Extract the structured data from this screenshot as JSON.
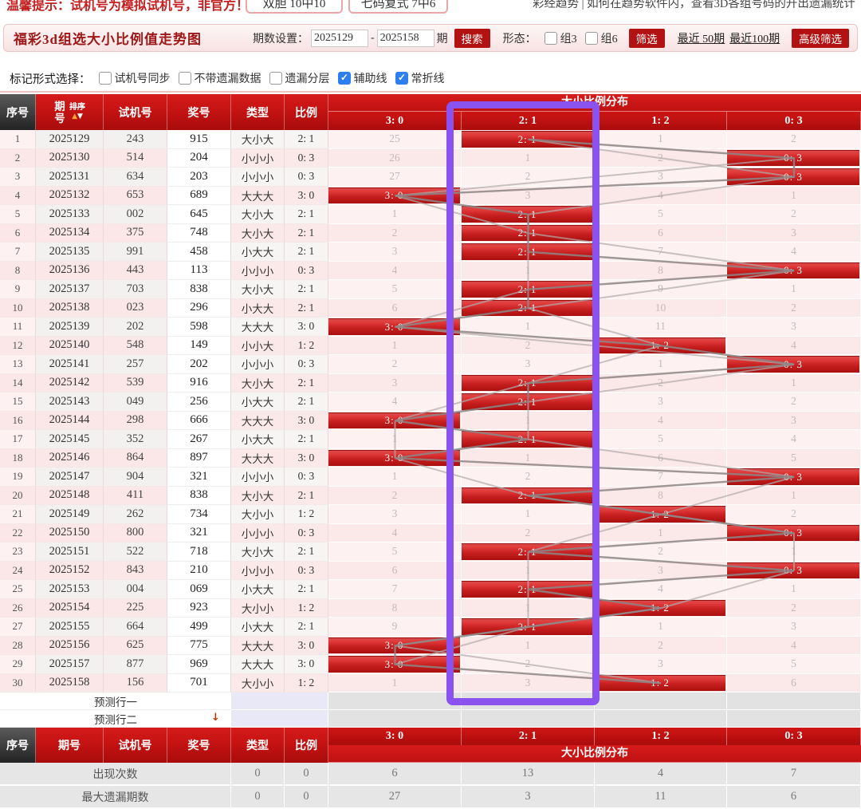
{
  "top_strip": {
    "notice": "温馨提示：试机号为模拟试机号，非官方！",
    "promo_buttons": [
      "双胆 10中10",
      "七码复式 7中6"
    ],
    "right_link": "彩经趋势 | 如何在趋势软件内，查看3D各组号码的开出遗漏统计"
  },
  "toolbar": {
    "title": "福彩3d组选大小比例值走势图",
    "period_label": "期数设置：",
    "period_from": "2025129",
    "dash": "-",
    "period_to": "2025158",
    "period_unit": "期",
    "search_button": "搜索",
    "shape_label": "形态：",
    "shape_options": [
      {
        "label": "组3",
        "checked": false
      },
      {
        "label": "组6",
        "checked": false
      }
    ],
    "filter_button": "筛选",
    "recent_50": "最近 50期",
    "recent_100": "最近100期",
    "advanced_button": "高级筛选"
  },
  "mark_row": {
    "label": "标记形式选择：",
    "options": [
      {
        "label": "试机号同步",
        "checked": false
      },
      {
        "label": "不带遗漏数据",
        "checked": false
      },
      {
        "label": "遗漏分层",
        "checked": false
      },
      {
        "label": "辅助线",
        "checked": true
      },
      {
        "label": "常折线",
        "checked": true
      }
    ]
  },
  "table": {
    "headers": {
      "seq": "序号",
      "period": "期号",
      "sort": "排序",
      "sort_up": "▲",
      "sort_down": "▼",
      "test": "试机号",
      "prize": "奖号",
      "type": "类型",
      "ratio": "比例",
      "dist": "大小比例分布"
    },
    "ratio_headers": [
      "3: 0",
      "2: 1",
      "1: 2",
      "0: 3"
    ],
    "rows": [
      {
        "seq": "1",
        "period": "2025129",
        "test": "243",
        "prize": "915",
        "type": "大小大",
        "ratio": "2: 1",
        "hit": 1,
        "cells": [
          "25",
          "2: 1",
          "1",
          "2"
        ]
      },
      {
        "seq": "2",
        "period": "2025130",
        "test": "514",
        "prize": "204",
        "type": "小小小",
        "ratio": "0: 3",
        "hit": 3,
        "cells": [
          "26",
          "1",
          "2",
          "0: 3"
        ]
      },
      {
        "seq": "3",
        "period": "2025131",
        "test": "634",
        "prize": "203",
        "type": "小小小",
        "ratio": "0: 3",
        "hit": 3,
        "cells": [
          "27",
          "2",
          "3",
          "0: 3"
        ]
      },
      {
        "seq": "4",
        "period": "2025132",
        "test": "653",
        "prize": "689",
        "type": "大大大",
        "ratio": "3: 0",
        "hit": 0,
        "cells": [
          "3: 0",
          "3",
          "4",
          "1"
        ]
      },
      {
        "seq": "5",
        "period": "2025133",
        "test": "002",
        "prize": "645",
        "type": "大小大",
        "ratio": "2: 1",
        "hit": 1,
        "cells": [
          "1",
          "2: 1",
          "5",
          "2"
        ]
      },
      {
        "seq": "6",
        "period": "2025134",
        "test": "375",
        "prize": "748",
        "type": "大小大",
        "ratio": "2: 1",
        "hit": 1,
        "cells": [
          "2",
          "2: 1",
          "6",
          "3"
        ]
      },
      {
        "seq": "7",
        "period": "2025135",
        "test": "991",
        "prize": "458",
        "type": "小大大",
        "ratio": "2: 1",
        "hit": 1,
        "cells": [
          "3",
          "2: 1",
          "7",
          "4"
        ]
      },
      {
        "seq": "8",
        "period": "2025136",
        "test": "443",
        "prize": "113",
        "type": "小小小",
        "ratio": "0: 3",
        "hit": 3,
        "cells": [
          "4",
          "1",
          "8",
          "0: 3"
        ]
      },
      {
        "seq": "9",
        "period": "2025137",
        "test": "703",
        "prize": "838",
        "type": "大小大",
        "ratio": "2: 1",
        "hit": 1,
        "cells": [
          "5",
          "2: 1",
          "9",
          "1"
        ]
      },
      {
        "seq": "10",
        "period": "2025138",
        "test": "023",
        "prize": "296",
        "type": "小大大",
        "ratio": "2: 1",
        "hit": 1,
        "cells": [
          "6",
          "2: 1",
          "10",
          "2"
        ]
      },
      {
        "seq": "11",
        "period": "2025139",
        "test": "202",
        "prize": "598",
        "type": "大大大",
        "ratio": "3: 0",
        "hit": 0,
        "cells": [
          "3: 0",
          "1",
          "11",
          "3"
        ]
      },
      {
        "seq": "12",
        "period": "2025140",
        "test": "548",
        "prize": "149",
        "type": "小小大",
        "ratio": "1: 2",
        "hit": 2,
        "cells": [
          "1",
          "2",
          "1: 2",
          "4"
        ]
      },
      {
        "seq": "13",
        "period": "2025141",
        "test": "257",
        "prize": "202",
        "type": "小小小",
        "ratio": "0: 3",
        "hit": 3,
        "cells": [
          "2",
          "3",
          "1",
          "0: 3"
        ]
      },
      {
        "seq": "14",
        "period": "2025142",
        "test": "539",
        "prize": "916",
        "type": "大小大",
        "ratio": "2: 1",
        "hit": 1,
        "cells": [
          "3",
          "2: 1",
          "2",
          "1"
        ]
      },
      {
        "seq": "15",
        "period": "2025143",
        "test": "049",
        "prize": "256",
        "type": "小大大",
        "ratio": "2: 1",
        "hit": 1,
        "cells": [
          "4",
          "2: 1",
          "3",
          "2"
        ]
      },
      {
        "seq": "16",
        "period": "2025144",
        "test": "298",
        "prize": "666",
        "type": "大大大",
        "ratio": "3: 0",
        "hit": 0,
        "cells": [
          "3: 0",
          "1",
          "4",
          "3"
        ]
      },
      {
        "seq": "17",
        "period": "2025145",
        "test": "352",
        "prize": "267",
        "type": "小大大",
        "ratio": "2: 1",
        "hit": 1,
        "cells": [
          "1",
          "2: 1",
          "5",
          "4"
        ]
      },
      {
        "seq": "18",
        "period": "2025146",
        "test": "864",
        "prize": "897",
        "type": "大大大",
        "ratio": "3: 0",
        "hit": 0,
        "cells": [
          "3: 0",
          "1",
          "6",
          "5"
        ]
      },
      {
        "seq": "19",
        "period": "2025147",
        "test": "904",
        "prize": "321",
        "type": "小小小",
        "ratio": "0: 3",
        "hit": 3,
        "cells": [
          "1",
          "2",
          "7",
          "0: 3"
        ]
      },
      {
        "seq": "20",
        "period": "2025148",
        "test": "411",
        "prize": "838",
        "type": "大小大",
        "ratio": "2: 1",
        "hit": 1,
        "cells": [
          "2",
          "2: 1",
          "8",
          "1"
        ]
      },
      {
        "seq": "21",
        "period": "2025149",
        "test": "262",
        "prize": "734",
        "type": "大小小",
        "ratio": "1: 2",
        "hit": 2,
        "cells": [
          "3",
          "1",
          "1: 2",
          "2"
        ]
      },
      {
        "seq": "22",
        "period": "2025150",
        "test": "800",
        "prize": "321",
        "type": "小小小",
        "ratio": "0: 3",
        "hit": 3,
        "cells": [
          "4",
          "2",
          "1",
          "0: 3"
        ]
      },
      {
        "seq": "23",
        "period": "2025151",
        "test": "522",
        "prize": "718",
        "type": "大小大",
        "ratio": "2: 1",
        "hit": 1,
        "cells": [
          "5",
          "2: 1",
          "2",
          "1"
        ]
      },
      {
        "seq": "24",
        "period": "2025152",
        "test": "843",
        "prize": "210",
        "type": "小小小",
        "ratio": "0: 3",
        "hit": 3,
        "cells": [
          "6",
          "1",
          "3",
          "0: 3"
        ]
      },
      {
        "seq": "25",
        "period": "2025153",
        "test": "004",
        "prize": "069",
        "type": "小大大",
        "ratio": "2: 1",
        "hit": 1,
        "cells": [
          "7",
          "2: 1",
          "4",
          "1"
        ]
      },
      {
        "seq": "26",
        "period": "2025154",
        "test": "225",
        "prize": "923",
        "type": "大小小",
        "ratio": "1: 2",
        "hit": 2,
        "cells": [
          "8",
          "1",
          "1: 2",
          "2"
        ]
      },
      {
        "seq": "27",
        "period": "2025155",
        "test": "664",
        "prize": "499",
        "type": "小大大",
        "ratio": "2: 1",
        "hit": 1,
        "cells": [
          "9",
          "2: 1",
          "1",
          "3"
        ]
      },
      {
        "seq": "28",
        "period": "2025156",
        "test": "625",
        "prize": "775",
        "type": "大大大",
        "ratio": "3: 0",
        "hit": 0,
        "cells": [
          "3: 0",
          "1",
          "2",
          "4"
        ]
      },
      {
        "seq": "29",
        "period": "2025157",
        "test": "877",
        "prize": "969",
        "type": "大大大",
        "ratio": "3: 0",
        "hit": 0,
        "cells": [
          "3: 0",
          "2",
          "3",
          "5"
        ]
      },
      {
        "seq": "30",
        "period": "2025158",
        "test": "156",
        "prize": "701",
        "type": "大小小",
        "ratio": "1: 2",
        "hit": 2,
        "cells": [
          "1",
          "3",
          "1: 2",
          "6"
        ]
      }
    ],
    "predict_rows": [
      "预测行一",
      "预测行二"
    ],
    "down_arrow": "↓",
    "stats": [
      {
        "label": "出现次数",
        "type_val": "0",
        "ratio_val": "0",
        "values": [
          "6",
          "13",
          "4",
          "7"
        ]
      },
      {
        "label": "最大遗漏期数",
        "type_val": "0",
        "ratio_val": "0",
        "values": [
          "27",
          "3",
          "11",
          "6"
        ]
      }
    ]
  },
  "colors": {
    "accent_red": "#b31212",
    "header_red": "#c01111",
    "bar_red": "#c71f1f",
    "purple": "#8a52ef",
    "check_blue": "#2d7ef0",
    "lavender": "#e8e8f7"
  }
}
